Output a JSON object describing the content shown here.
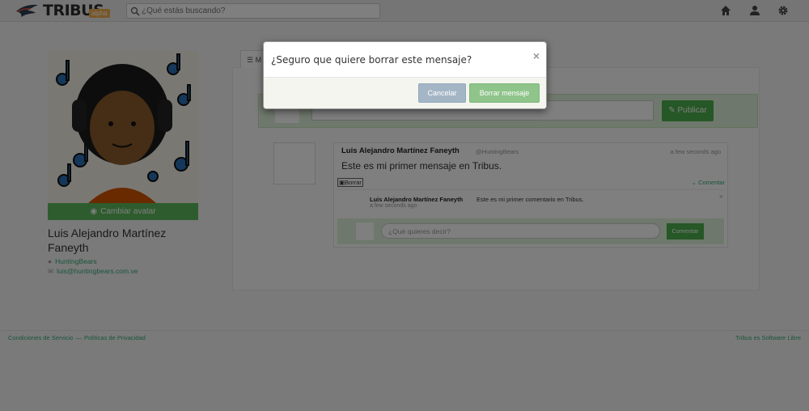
{
  "navbar": {
    "logo_text": "TRIBUS",
    "logo_badge": "alpha",
    "search_placeholder": "¿Qué estás buscando?",
    "icons": [
      "home-icon",
      "user-icon",
      "gear-icon"
    ]
  },
  "profile": {
    "change_avatar_label": "Cambiar avatar",
    "name": "Luis Alejandro Martínez Faneyth",
    "username": "HuntingBears",
    "email": "luis@huntingbears.com.ve"
  },
  "timeline": {
    "tab_label": "M",
    "post_button_label": "Publicar",
    "message": {
      "author": "Luis Alejandro Martínez Faneyth",
      "handle": "@HuntingBears",
      "time": "a few seconds ago",
      "text": "Este es mi primer mensaje en Tribus.",
      "delete_label": "Borrar",
      "comment_label": "Comentar"
    },
    "comment": {
      "author": "Luis Alejandro Martínez Faneyth",
      "text": "Este es mi primer comentario en Tribus.",
      "time": "a few seconds ago"
    },
    "reply_placeholder": "¿Qué quieres decir?",
    "reply_button_label": "Comentar"
  },
  "footer": {
    "terms": "Condiciones de Servicio",
    "separator": "—",
    "privacy": "Políticas de Privacidad",
    "right_text": "Tribus es Software Libre"
  },
  "modal": {
    "title": "¿Seguro que quiere borrar este mensaje?",
    "close_glyph": "×",
    "cancel_label": "Cancelar",
    "confirm_label": "Borrar mensaje"
  },
  "colors": {
    "accent_green": "#5cb85c",
    "cancel_button": "#a4b6c6",
    "confirm_button": "#8fc48a",
    "overlay": "rgba(0,0,0,0.5)"
  }
}
